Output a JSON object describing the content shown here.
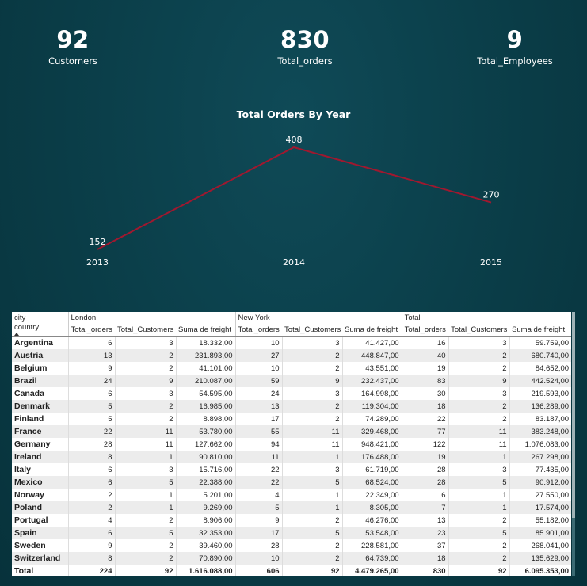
{
  "kpis": {
    "customers": {
      "value": "92",
      "label": "Customers"
    },
    "orders": {
      "value": "830",
      "label": "Total_orders"
    },
    "employees": {
      "value": "9",
      "label": "Total_Employees"
    }
  },
  "chart_data": {
    "type": "line",
    "title": "Total Orders By Year",
    "categories": [
      "2013",
      "2014",
      "2015"
    ],
    "values": [
      152,
      408,
      270
    ],
    "line_color": "#a0182f"
  },
  "table": {
    "row_header_top": "city",
    "row_header_bottom": "country",
    "sort_icon": "sort-up-icon",
    "groups": [
      "London",
      "New York",
      "Total"
    ],
    "columns": [
      "Total_orders",
      "Total_Customers",
      "Suma de freight"
    ],
    "rows": [
      [
        "Argentina",
        "6",
        "3",
        "18.332,00",
        "10",
        "3",
        "41.427,00",
        "16",
        "3",
        "59.759,00"
      ],
      [
        "Austria",
        "13",
        "2",
        "231.893,00",
        "27",
        "2",
        "448.847,00",
        "40",
        "2",
        "680.740,00"
      ],
      [
        "Belgium",
        "9",
        "2",
        "41.101,00",
        "10",
        "2",
        "43.551,00",
        "19",
        "2",
        "84.652,00"
      ],
      [
        "Brazil",
        "24",
        "9",
        "210.087,00",
        "59",
        "9",
        "232.437,00",
        "83",
        "9",
        "442.524,00"
      ],
      [
        "Canada",
        "6",
        "3",
        "54.595,00",
        "24",
        "3",
        "164.998,00",
        "30",
        "3",
        "219.593,00"
      ],
      [
        "Denmark",
        "5",
        "2",
        "16.985,00",
        "13",
        "2",
        "119.304,00",
        "18",
        "2",
        "136.289,00"
      ],
      [
        "Finland",
        "5",
        "2",
        "8.898,00",
        "17",
        "2",
        "74.289,00",
        "22",
        "2",
        "83.187,00"
      ],
      [
        "France",
        "22",
        "11",
        "53.780,00",
        "55",
        "11",
        "329.468,00",
        "77",
        "11",
        "383.248,00"
      ],
      [
        "Germany",
        "28",
        "11",
        "127.662,00",
        "94",
        "11",
        "948.421,00",
        "122",
        "11",
        "1.076.083,00"
      ],
      [
        "Ireland",
        "8",
        "1",
        "90.810,00",
        "11",
        "1",
        "176.488,00",
        "19",
        "1",
        "267.298,00"
      ],
      [
        "Italy",
        "6",
        "3",
        "15.716,00",
        "22",
        "3",
        "61.719,00",
        "28",
        "3",
        "77.435,00"
      ],
      [
        "Mexico",
        "6",
        "5",
        "22.388,00",
        "22",
        "5",
        "68.524,00",
        "28",
        "5",
        "90.912,00"
      ],
      [
        "Norway",
        "2",
        "1",
        "5.201,00",
        "4",
        "1",
        "22.349,00",
        "6",
        "1",
        "27.550,00"
      ],
      [
        "Poland",
        "2",
        "1",
        "9.269,00",
        "5",
        "1",
        "8.305,00",
        "7",
        "1",
        "17.574,00"
      ],
      [
        "Portugal",
        "4",
        "2",
        "8.906,00",
        "9",
        "2",
        "46.276,00",
        "13",
        "2",
        "55.182,00"
      ],
      [
        "Spain",
        "6",
        "5",
        "32.353,00",
        "17",
        "5",
        "53.548,00",
        "23",
        "5",
        "85.901,00"
      ],
      [
        "Sweden",
        "9",
        "2",
        "39.460,00",
        "28",
        "2",
        "228.581,00",
        "37",
        "2",
        "268.041,00"
      ],
      [
        "Switzerland",
        "8",
        "2",
        "70.890,00",
        "10",
        "2",
        "64.739,00",
        "18",
        "2",
        "135.629,00"
      ]
    ],
    "total": [
      "Total",
      "224",
      "92",
      "1.616.088,00",
      "606",
      "92",
      "4.479.265,00",
      "830",
      "92",
      "6.095.353,00"
    ]
  }
}
